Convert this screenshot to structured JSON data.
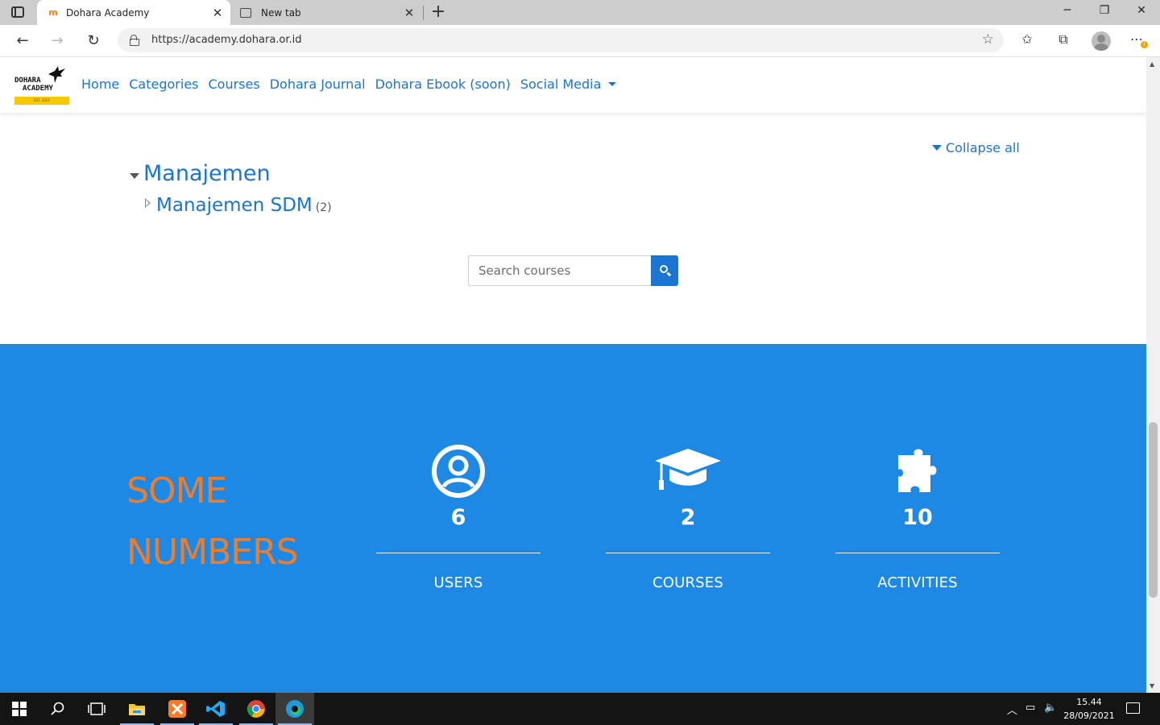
{
  "browser": {
    "tabs": [
      {
        "title": "Dohara Academy",
        "favicon": "moodle-icon",
        "active": true
      },
      {
        "title": "New tab",
        "favicon": "newtab-icon",
        "active": false
      }
    ],
    "url": "https://academy.dohara.or.id"
  },
  "site": {
    "logo": {
      "line1": "DOHARA",
      "line2": "ACADEMY",
      "strip_text": "EST. 2021"
    },
    "nav": [
      "Home",
      "Categories",
      "Courses",
      "Dohara Journal",
      "Dohara Ebook (soon)",
      "Social Media"
    ],
    "accent_color": "#1a74d2"
  },
  "categories": {
    "collapse_all": "Collapse all",
    "main": "Manajemen",
    "sub": {
      "name": "Manajemen SDM",
      "count": "(2)"
    }
  },
  "search": {
    "placeholder": "Search courses",
    "value": ""
  },
  "stats": {
    "title_line1": "SOME",
    "title_line2": "NUMBERS",
    "background": "#1e88e5",
    "title_color": "#ee7d2b",
    "items": [
      {
        "icon": "user-circle-icon",
        "value": "6",
        "label": "USERS"
      },
      {
        "icon": "graduation-cap-icon",
        "value": "2",
        "label": "COURSES"
      },
      {
        "icon": "puzzle-piece-icon",
        "value": "10",
        "label": "ACTIVITIES"
      }
    ]
  },
  "taskbar": {
    "apps": [
      "start-icon",
      "search-icon",
      "task-view-icon",
      "file-explorer-icon",
      "xampp-icon",
      "vscode-icon",
      "chrome-icon",
      "edge-icon"
    ],
    "time": "15.44",
    "date": "28/09/2021"
  }
}
